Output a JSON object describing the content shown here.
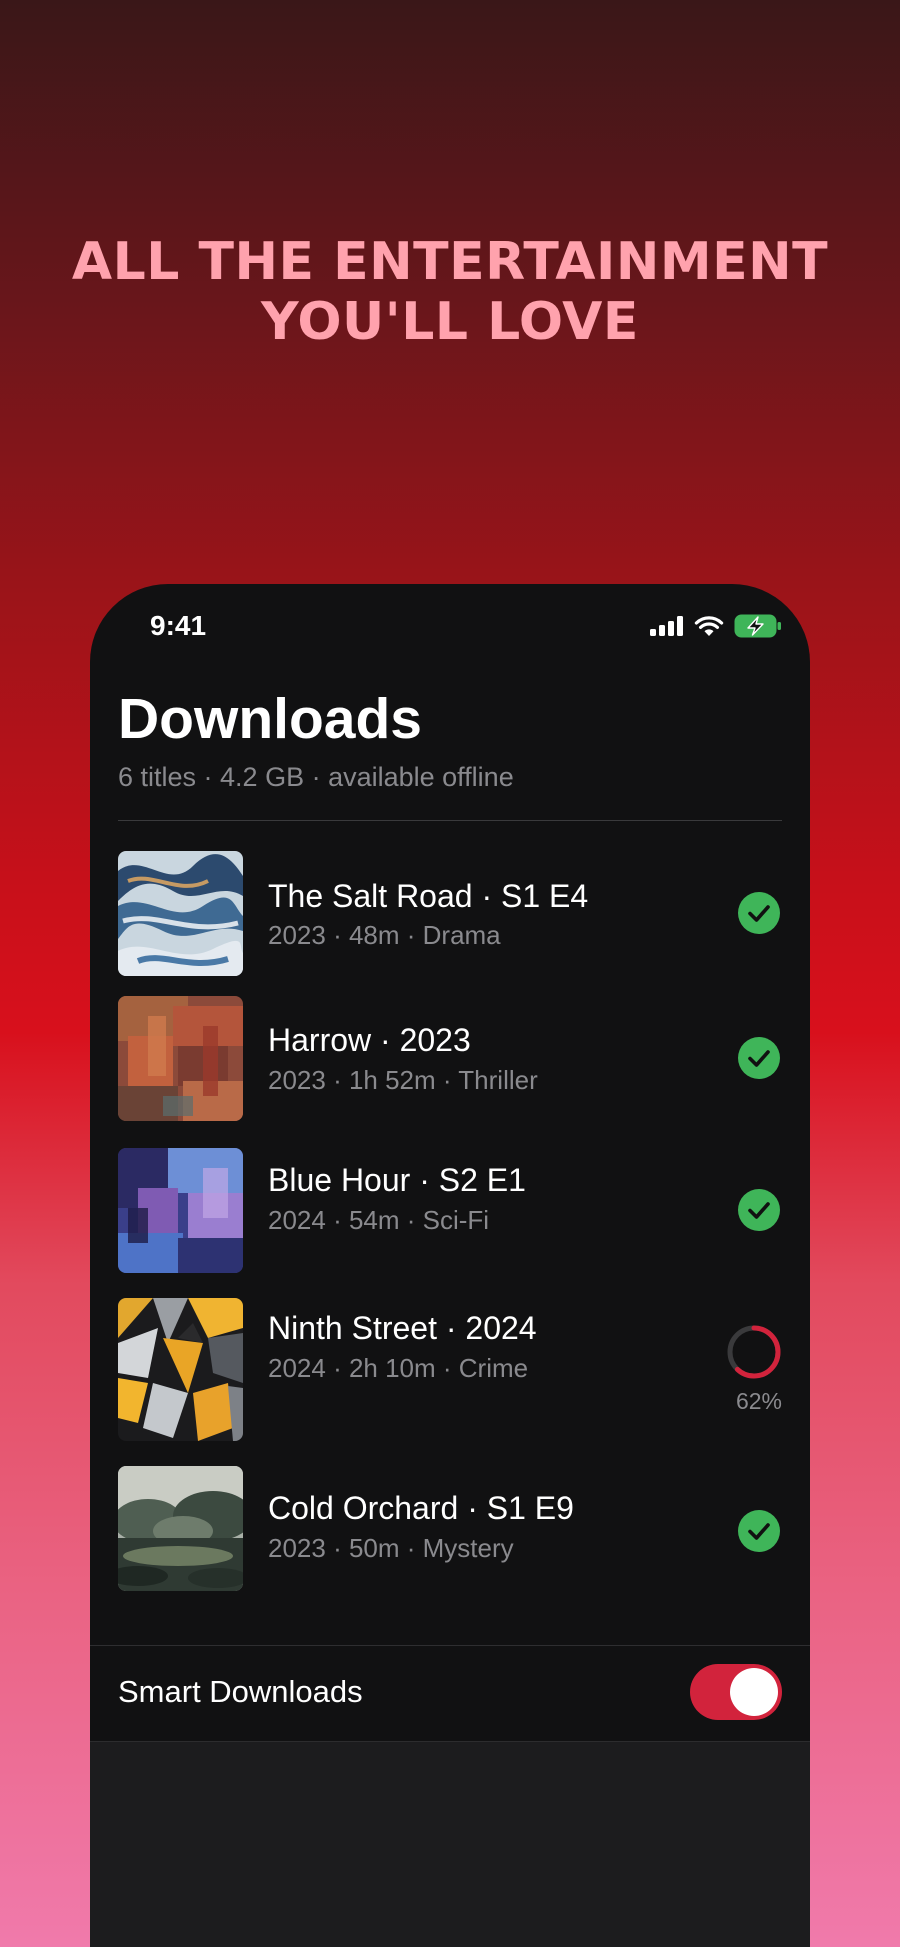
{
  "promo": {
    "line1": "ALL THE ENTERTAINMENT",
    "line2": "YOU'LL LOVE"
  },
  "status_bar": {
    "time": "9:41",
    "icons": [
      "signal-icon",
      "wifi-icon",
      "battery-charging-icon"
    ]
  },
  "downloads": {
    "title": "Downloads",
    "summary": "6 titles · 4.2 GB · available offline",
    "items": [
      {
        "title": "The Salt Road · S1 E4",
        "meta": "2023 · 48m · Drama",
        "status": "downloaded"
      },
      {
        "title": "Harrow · 2023",
        "meta": "2023 · 1h 52m · Thriller",
        "status": "downloaded"
      },
      {
        "title": "Blue Hour · S2 E1",
        "meta": "2024 · 54m · Sci-Fi",
        "status": "downloaded"
      },
      {
        "title": "Ninth Street · 2024",
        "meta": "2024 · 2h 10m · Crime",
        "status": "downloading",
        "progress_label": "62%",
        "progress": 0.62
      },
      {
        "title": "Cold Orchard · S1 E9",
        "meta": "2023 · 50m · Mystery",
        "status": "downloaded"
      }
    ]
  },
  "smart_downloads": {
    "label": "Smart Downloads",
    "enabled": true
  },
  "colors": {
    "headline": "#ffa2ad",
    "check": "#3fb559",
    "accent": "#d2233c",
    "secondary_text": "#8a8a8e"
  }
}
